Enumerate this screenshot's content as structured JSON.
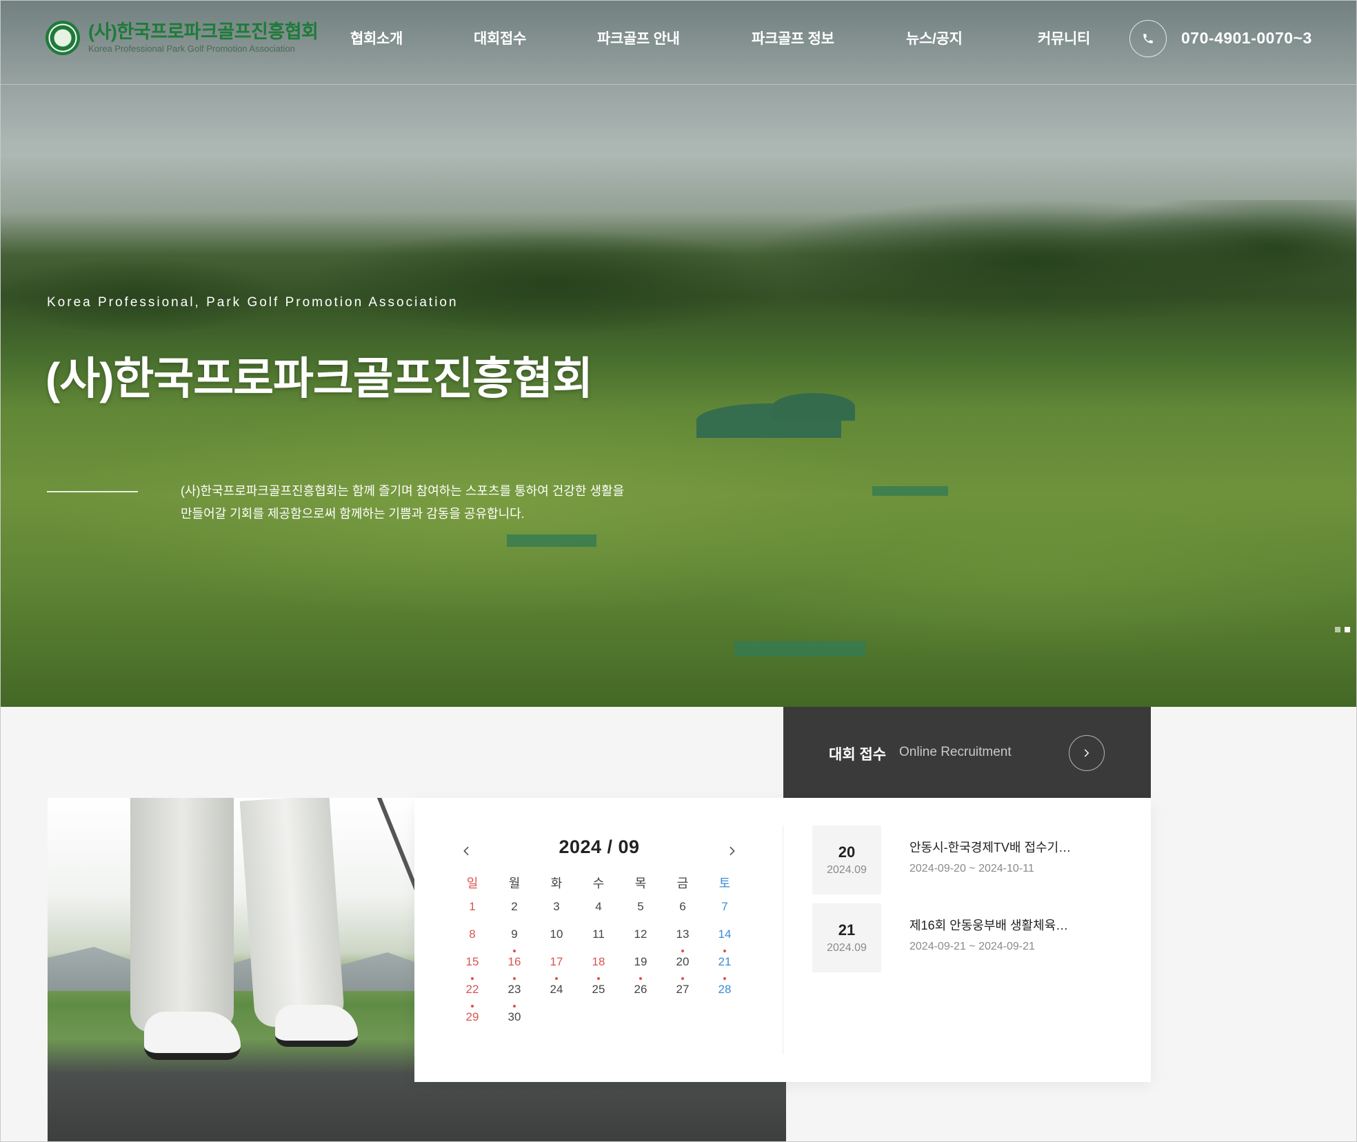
{
  "header": {
    "logo_ko": "(사)한국프로파크골프진흥협회",
    "logo_en": "Korea Professional Park Golf Promotion Association",
    "nav": [
      {
        "label": "협회소개"
      },
      {
        "label": "대회접수"
      },
      {
        "label": "파크골프 안내"
      },
      {
        "label": "파크골프 정보"
      },
      {
        "label": "뉴스/공지"
      },
      {
        "label": "커뮤니티"
      }
    ],
    "phone_icon": "phone-icon",
    "phone_number": "070-4901-0070~3"
  },
  "hero": {
    "eyebrow": "Korea Professional, Park Golf Promotion Association",
    "title": "(사)한국프로파크골프진흥협회",
    "description_line1": "(사)한국프로파크골프진흥협회는 함께 즐기며 참여하는 스포츠를 통하여 건강한 생활을",
    "description_line2": "만들어갈 기회를 제공함으로써 함께하는 기쁨과 감동을 공유합니다."
  },
  "recruit": {
    "title": "대회 접수",
    "subtitle": "Online Recruitment",
    "arrow_icon": "chevron-right-icon"
  },
  "calendar": {
    "title": "2024 / 09",
    "prev_icon": "chevron-left-icon",
    "next_icon": "chevron-right-icon",
    "weekdays": [
      "일",
      "월",
      "화",
      "수",
      "목",
      "금",
      "토"
    ],
    "weeks": [
      [
        {
          "d": "1"
        },
        {
          "d": "2"
        },
        {
          "d": "3"
        },
        {
          "d": "4"
        },
        {
          "d": "5"
        },
        {
          "d": "6"
        },
        {
          "d": "7"
        }
      ],
      [
        {
          "d": "8"
        },
        {
          "d": "9"
        },
        {
          "d": "10"
        },
        {
          "d": "11"
        },
        {
          "d": "12"
        },
        {
          "d": "13"
        },
        {
          "d": "14"
        }
      ],
      [
        {
          "d": "15",
          "holiday": true
        },
        {
          "d": "16",
          "holiday": true,
          "dot": true
        },
        {
          "d": "17",
          "holiday": true
        },
        {
          "d": "18",
          "holiday": true
        },
        {
          "d": "19"
        },
        {
          "d": "20",
          "dot": true
        },
        {
          "d": "21",
          "dot": true
        }
      ],
      [
        {
          "d": "22",
          "dot": true
        },
        {
          "d": "23",
          "dot": true
        },
        {
          "d": "24",
          "dot": true
        },
        {
          "d": "25",
          "dot": true
        },
        {
          "d": "26",
          "dot": true
        },
        {
          "d": "27",
          "dot": true
        },
        {
          "d": "28",
          "dot": true
        }
      ],
      [
        {
          "d": "29",
          "dot": true
        },
        {
          "d": "30",
          "dot": true
        }
      ]
    ],
    "colors": {
      "sunday": "#d9534f",
      "saturday": "#3a8bd6",
      "event_dot": "#e04d4d"
    }
  },
  "events": [
    {
      "day": "20",
      "ym": "2024.09",
      "title": "안동시-한국경제TV배 접수기…",
      "range": "2024-09-20 ~ 2024-10-11"
    },
    {
      "day": "21",
      "ym": "2024.09",
      "title": "제16회 안동웅부배 생활체육…",
      "range": "2024-09-21 ~ 2024-09-21"
    }
  ]
}
